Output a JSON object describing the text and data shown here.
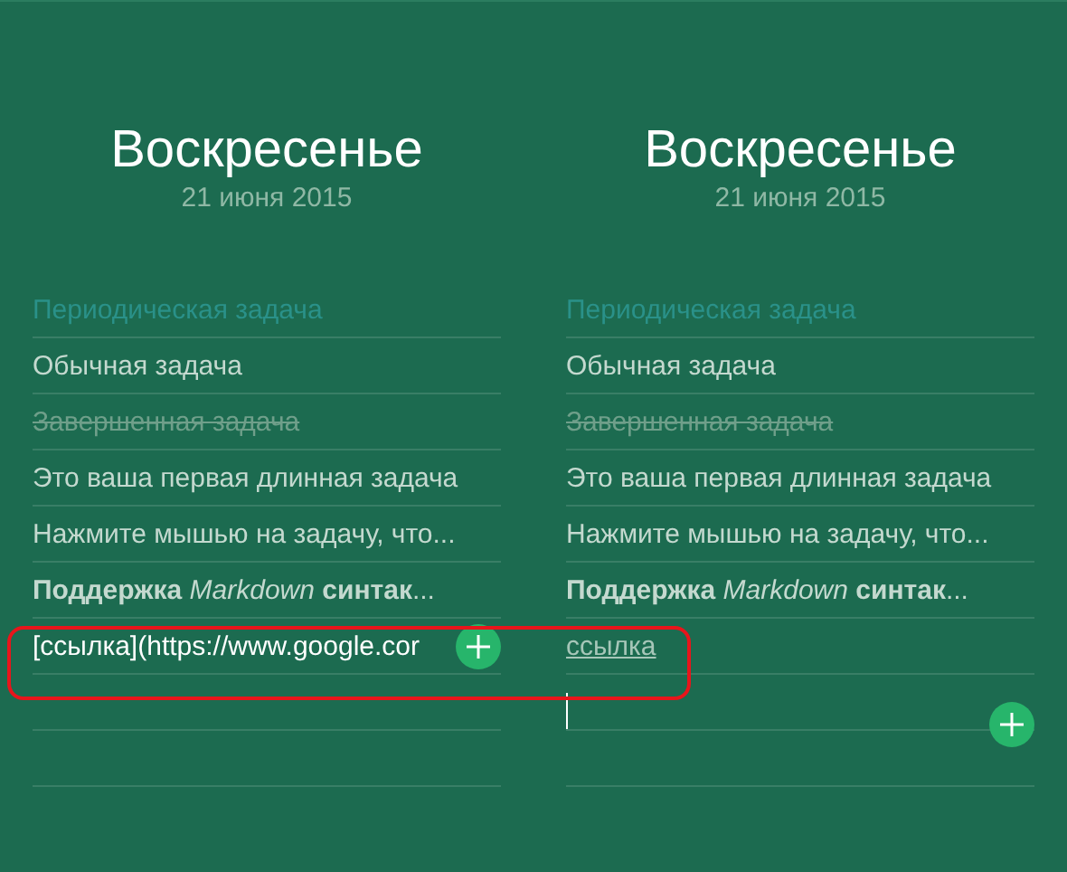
{
  "panels": [
    {
      "day": "Воскресенье",
      "date": "21 июня 2015",
      "tasks": [
        {
          "kind": "periodic",
          "text": "Периодическая задача"
        },
        {
          "kind": "normal",
          "text": "Обычная задача"
        },
        {
          "kind": "done",
          "text": "Завершенная задача"
        },
        {
          "kind": "normal",
          "text": "Это ваша первая длинная задача"
        },
        {
          "kind": "normal",
          "text": "Нажмите мышью на задачу, что..."
        },
        {
          "kind": "rich",
          "text": "**Поддержка** *Markdown* **синтак**..."
        },
        {
          "kind": "editing",
          "value": "[ссылка](https://www.google.cor"
        },
        {
          "kind": "empty"
        },
        {
          "kind": "empty"
        }
      ]
    },
    {
      "day": "Воскресенье",
      "date": "21 июня 2015",
      "tasks": [
        {
          "kind": "periodic",
          "text": "Периодическая задача"
        },
        {
          "kind": "normal",
          "text": "Обычная задача"
        },
        {
          "kind": "done",
          "text": "Завершенная задача"
        },
        {
          "kind": "normal",
          "text": "Это ваша первая длинная задача"
        },
        {
          "kind": "normal",
          "text": "Нажмите мышью на задачу, что..."
        },
        {
          "kind": "rich",
          "text": "**Поддержка** *Markdown* **синтак**..."
        },
        {
          "kind": "link",
          "text": "ссылка"
        },
        {
          "kind": "cursor"
        },
        {
          "kind": "empty"
        }
      ]
    }
  ],
  "annotation_outline": true
}
